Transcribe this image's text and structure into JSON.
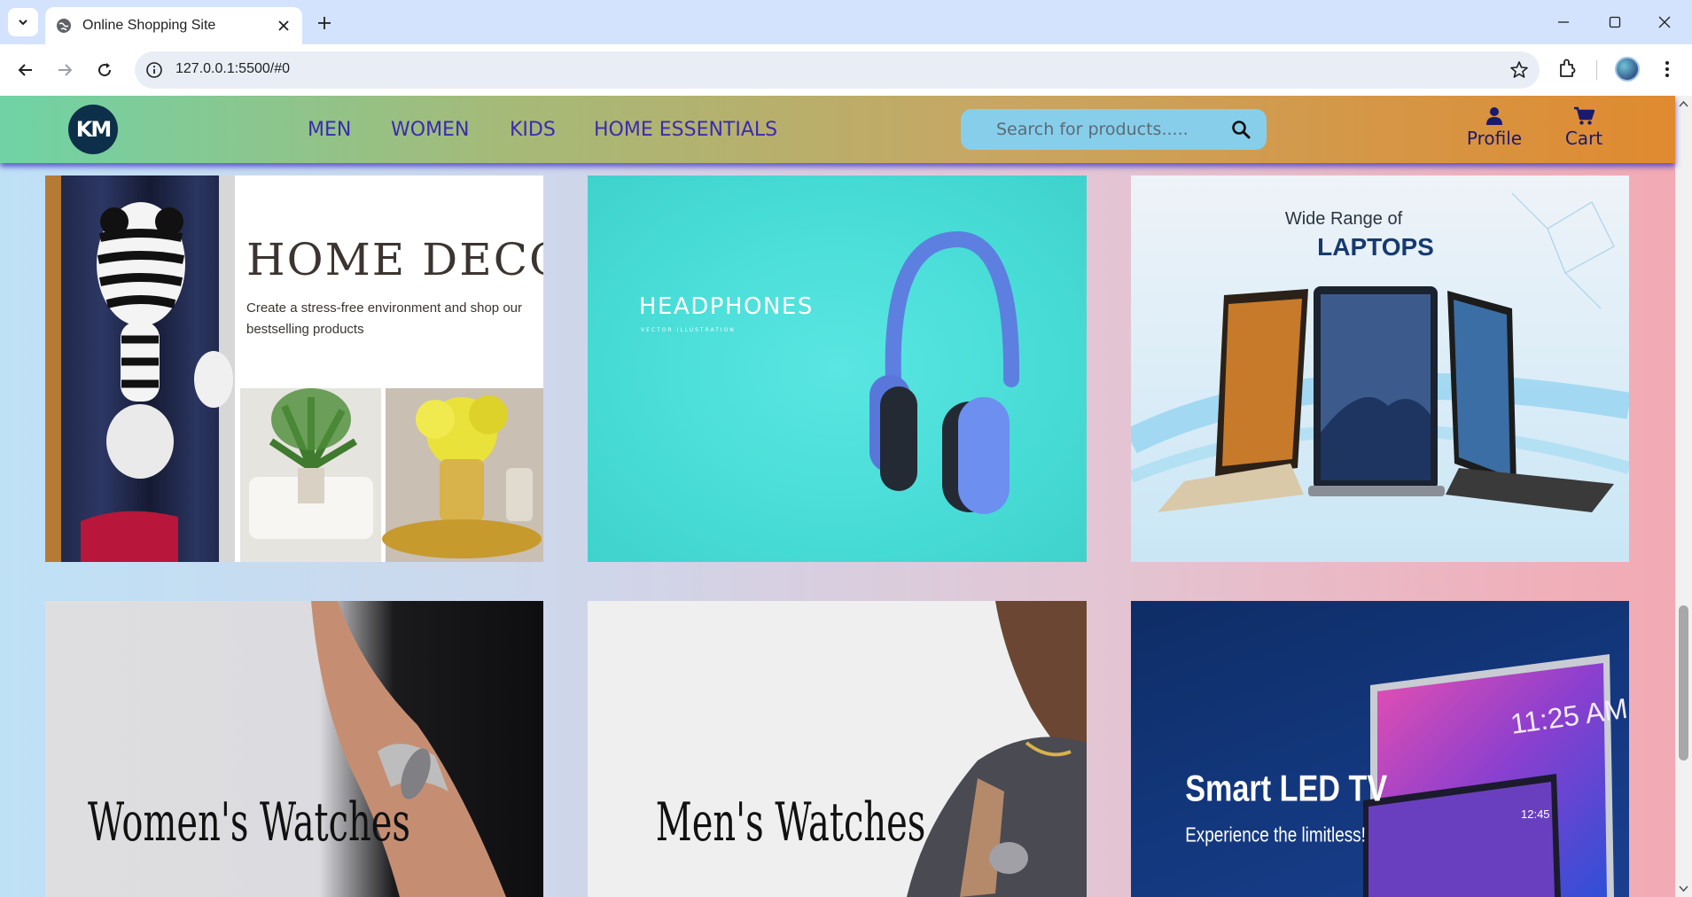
{
  "browser": {
    "tab_title": "Online Shopping Site",
    "url": "127.0.0.1:5500/#0"
  },
  "site": {
    "logo_text": "KM",
    "nav": [
      "MEN",
      "WOMEN",
      "KIDS",
      "HOME ESSENTIALS"
    ],
    "search_placeholder": "Search for products.....",
    "profile_label": "Profile",
    "cart_label": "Cart"
  },
  "cards": {
    "home_decor": {
      "title": "HOME DECOR",
      "subtitle_line1": "Create a stress-free environment and shop our",
      "subtitle_line2": "bestselling products"
    },
    "headphones": {
      "title": "HEADPHONES",
      "caption": "VECTOR ILLUSTRATION"
    },
    "laptops": {
      "line1": "Wide Range of",
      "line2": "LAPTOPS"
    },
    "womens_watches": {
      "title": "Women's Watches"
    },
    "mens_watches": {
      "title": "Men's Watches"
    },
    "smart_tv": {
      "title": "Smart LED TV",
      "subtitle": "Experience the limitless!",
      "time_big": "11:25 AM",
      "time_small": "12:45"
    }
  },
  "colors": {
    "nav_link": "#3b2bb0",
    "search_bg": "#87ceeb",
    "headphones_bg": "#48dcd6"
  }
}
